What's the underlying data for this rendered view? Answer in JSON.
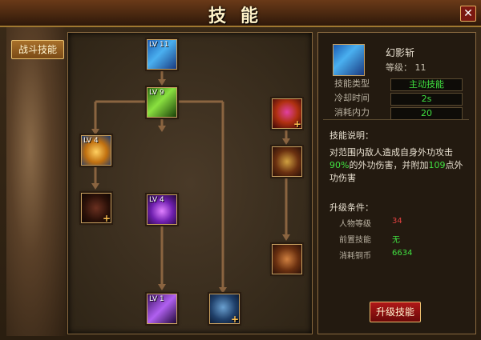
{
  "window": {
    "title": "技能",
    "close_label": "✕"
  },
  "tab": {
    "label": "战斗技能"
  },
  "colors": {
    "accent": "#c8a060",
    "value_green": "#40e040",
    "value_red": "#e04040",
    "button_red": "#b01818"
  },
  "skill_tree": [
    {
      "id": "skill-1",
      "level_label": "LV 11",
      "locked": false,
      "icon": "blue-slash-icon"
    },
    {
      "id": "skill-2",
      "level_label": "LV 9",
      "locked": false,
      "icon": "green-slash-icon"
    },
    {
      "id": "skill-3",
      "level_label": "LV 4",
      "locked": false,
      "icon": "golden-bell-icon"
    },
    {
      "id": "skill-4",
      "level_label": "LV 4",
      "locked": false,
      "icon": "purple-swirl-icon"
    },
    {
      "id": "skill-5",
      "level_label": "LV 1",
      "locked": false,
      "icon": "purple-claw-icon"
    },
    {
      "id": "skill-6",
      "level_label": "",
      "locked": true,
      "icon": "shadow-figure-icon"
    },
    {
      "id": "skill-7",
      "level_label": "",
      "locked": true,
      "icon": "blue-orb-icon"
    },
    {
      "id": "skill-8",
      "level_label": "",
      "locked": true,
      "icon": "flame-swirl-icon"
    },
    {
      "id": "skill-9",
      "level_label": "",
      "locked": true,
      "icon": "fire-burst-icon"
    },
    {
      "id": "skill-10",
      "level_label": "",
      "locked": true,
      "icon": "fire-claw-icon"
    }
  ],
  "unlock_marker": "+",
  "detail": {
    "name": "幻影斩",
    "grade_label": "等级：",
    "grade_value": "11",
    "icon": "blue-slash-icon",
    "stats": [
      {
        "label": "技能类型",
        "value": "主动技能"
      },
      {
        "label": "冷却时间",
        "value": "2s"
      },
      {
        "label": "消耗内力",
        "value": "20"
      }
    ],
    "desc_label": "技能说明：",
    "desc_part1": "对范围内敌人造成自身外功攻击",
    "desc_pct": "90%",
    "desc_part2": "的外功伤害，并附加",
    "desc_num": "109",
    "desc_part3": "点外功伤害",
    "req_label": "升级条件：",
    "requirements": [
      {
        "label": "人物等级",
        "value": "34",
        "color": "#e04040"
      },
      {
        "label": "前置技能",
        "value": "无",
        "color": "#40e040"
      },
      {
        "label": "消耗铜币",
        "value": "6634",
        "color": "#40e040"
      }
    ],
    "upgrade_button": "升级技能"
  }
}
